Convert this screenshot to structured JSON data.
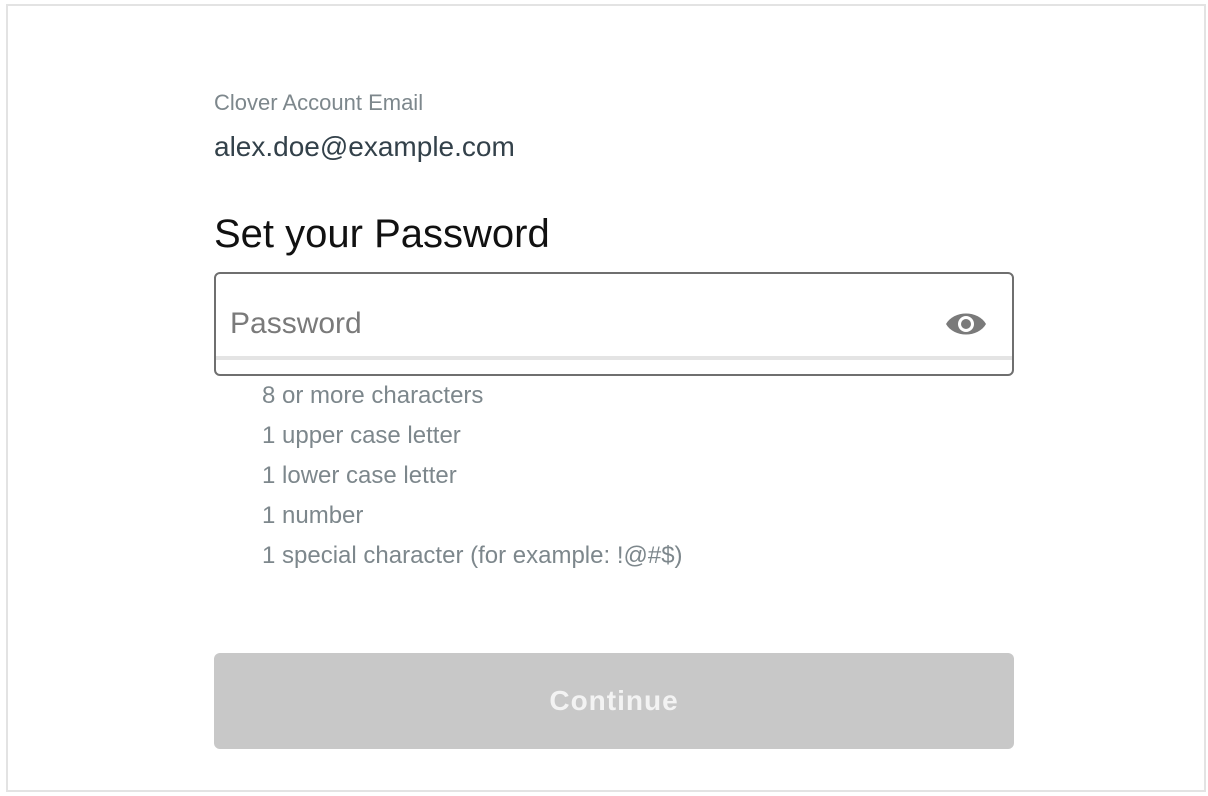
{
  "account": {
    "email_label": "Clover Account Email",
    "email_value": "alex.doe@example.com"
  },
  "form": {
    "heading": "Set your Password",
    "password_value": "",
    "password_placeholder": "Password",
    "show_password_icon": "eye-icon",
    "requirements": [
      "8 or more characters",
      "1 upper case letter",
      "1 lower case letter",
      "1 number",
      "1 special character (for example: !@#$)"
    ],
    "continue_label": "Continue",
    "continue_enabled": false
  },
  "colors": {
    "label_gray": "#7d878c",
    "email_text": "#33414a",
    "button_disabled_bg": "#c8c8c8",
    "button_disabled_text": "#f3f3f3",
    "input_border": "#6f6f6f"
  }
}
